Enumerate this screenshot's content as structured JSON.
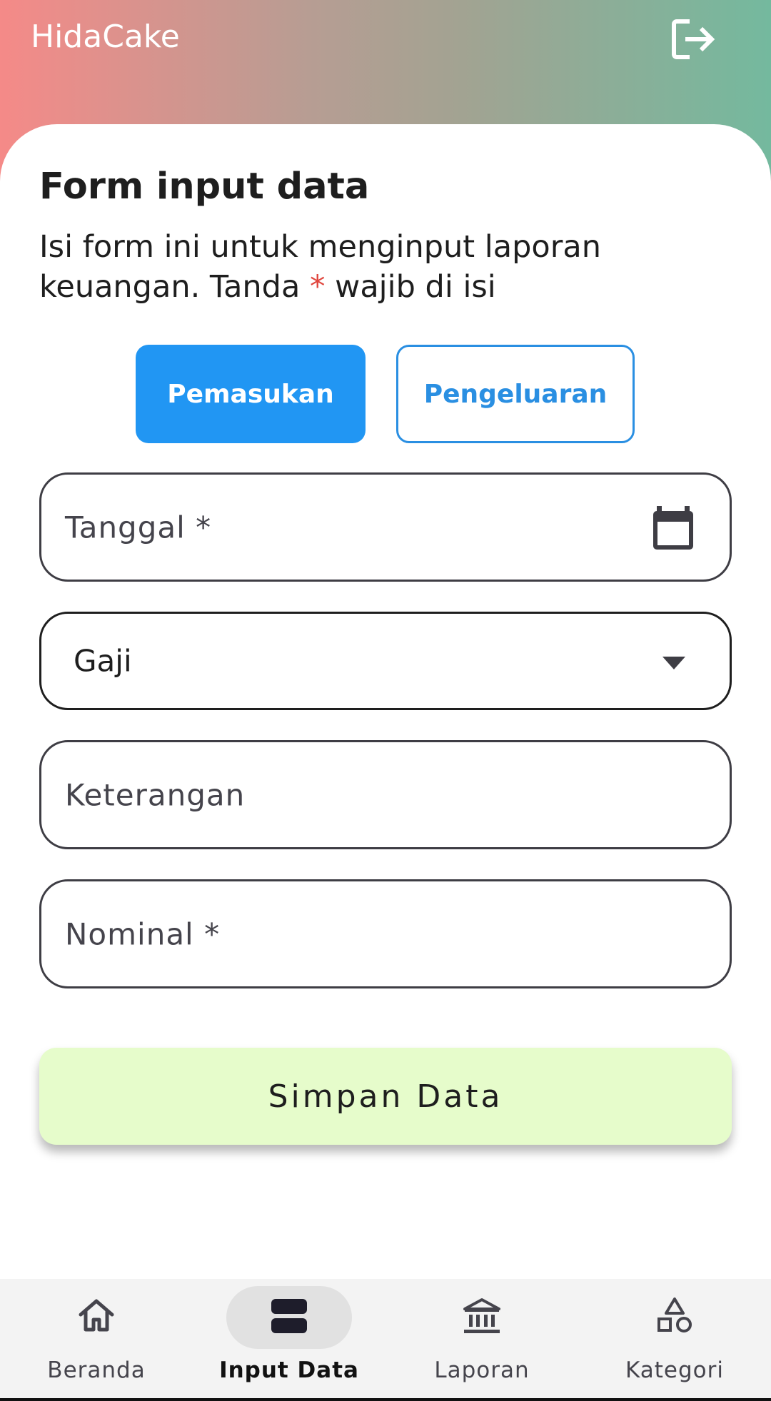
{
  "app": {
    "title": "HidaCake"
  },
  "header": {
    "logout_icon": "logout-icon"
  },
  "form": {
    "title": "Form input data",
    "desc_before": "Isi form ini untuk menginput laporan keuangan. Tanda ",
    "desc_star": "*",
    "desc_after": " wajib di isi",
    "types": {
      "income": "Pemasukan",
      "expense": "Pengeluaran",
      "selected": "Pemasukan"
    },
    "date_placeholder": "Tanggal *",
    "category_value": "Gaji",
    "description_placeholder": "Keterangan",
    "amount_placeholder": "Nominal *",
    "save_label": "Simpan Data"
  },
  "nav": {
    "items": [
      {
        "label": "Beranda",
        "icon": "home-icon"
      },
      {
        "label": "Input Data",
        "icon": "input-data-icon",
        "active": true
      },
      {
        "label": "Laporan",
        "icon": "bank-icon"
      },
      {
        "label": "Kategori",
        "icon": "shapes-icon"
      }
    ]
  },
  "colors": {
    "header_gradient_start": "#f58a88",
    "header_gradient_end": "#74b99e",
    "primary": "#2196f3",
    "required_star": "#e0463e",
    "save_button": "#e6fccb"
  }
}
